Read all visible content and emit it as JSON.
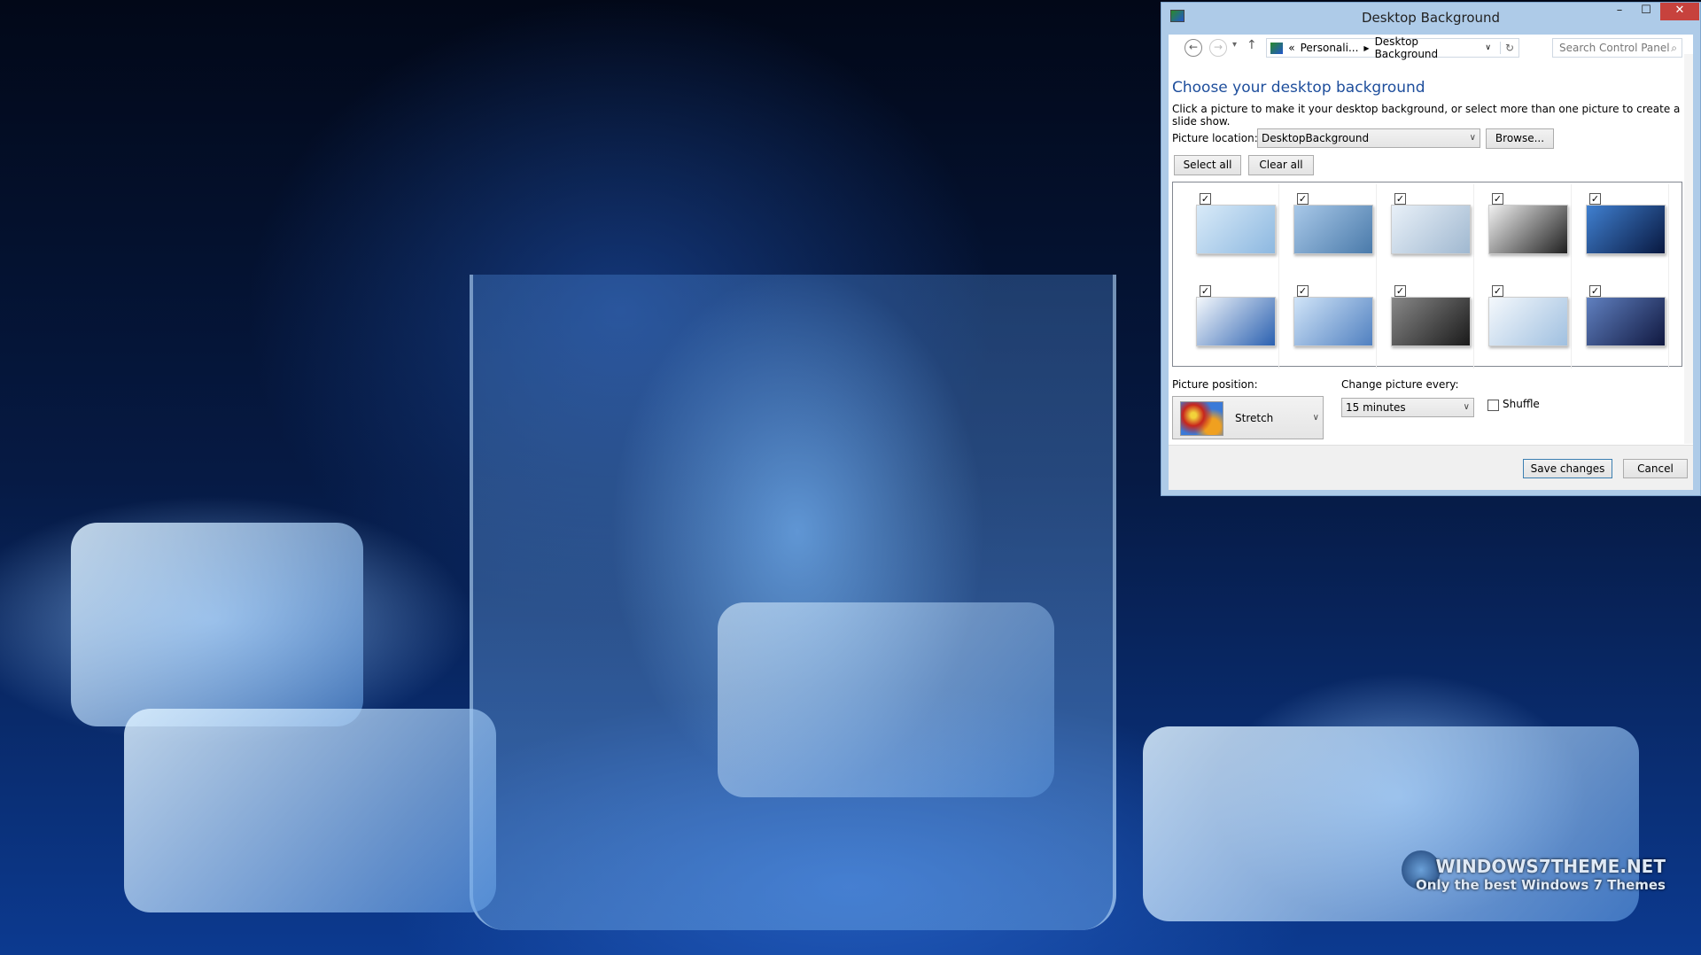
{
  "window": {
    "title": "Desktop Background",
    "minimize": "–",
    "maximize": "☐",
    "close": "✕"
  },
  "nav": {
    "back": "←",
    "forward": "→",
    "recent": "▾",
    "up": "↑",
    "breadcrumb_prefix": "«",
    "breadcrumb": [
      "Personali...",
      "Desktop Background"
    ],
    "refresh": "↻",
    "search_placeholder": "Search Control Panel",
    "search_icon": "⌕"
  },
  "main": {
    "heading": "Choose your desktop background",
    "description": "Click a picture to make it your desktop background, or select more than one picture to create a slide show.",
    "picture_location_label": "Picture location:",
    "picture_location_value": "DesktopBackground",
    "browse": "Browse...",
    "select_all": "Select all",
    "clear_all": "Clear all",
    "thumbnails": [
      {
        "checked": true,
        "colors": [
          "#d8eaf8",
          "#8db8e0"
        ]
      },
      {
        "checked": true,
        "colors": [
          "#a8c8e8",
          "#4a7aaa"
        ]
      },
      {
        "checked": true,
        "colors": [
          "#e8f0f8",
          "#a0b8d0"
        ]
      },
      {
        "checked": true,
        "colors": [
          "#f0f0f0",
          "#202020"
        ]
      },
      {
        "checked": true,
        "colors": [
          "#4080d0",
          "#081840"
        ]
      },
      {
        "checked": true,
        "colors": [
          "#f4f8fc",
          "#2a60b0"
        ]
      },
      {
        "checked": true,
        "colors": [
          "#d0e4f8",
          "#5080c0"
        ]
      },
      {
        "checked": true,
        "colors": [
          "#888888",
          "#1a1a1a"
        ]
      },
      {
        "checked": true,
        "colors": [
          "#f4f8fc",
          "#a0c0e0"
        ]
      },
      {
        "checked": true,
        "colors": [
          "#6080c0",
          "#101840"
        ]
      }
    ],
    "check_glyph": "✓",
    "picture_position_label": "Picture position:",
    "picture_position_value": "Stretch",
    "change_every_label": "Change picture every:",
    "change_every_value": "15 minutes",
    "shuffle_label": "Shuffle",
    "shuffle_checked": false
  },
  "footer": {
    "save": "Save changes",
    "cancel": "Cancel"
  },
  "desktop": {
    "watermark_line1": "WINDOWS7THEME.NET",
    "watermark_line2": "Only the best Windows 7 Themes"
  }
}
